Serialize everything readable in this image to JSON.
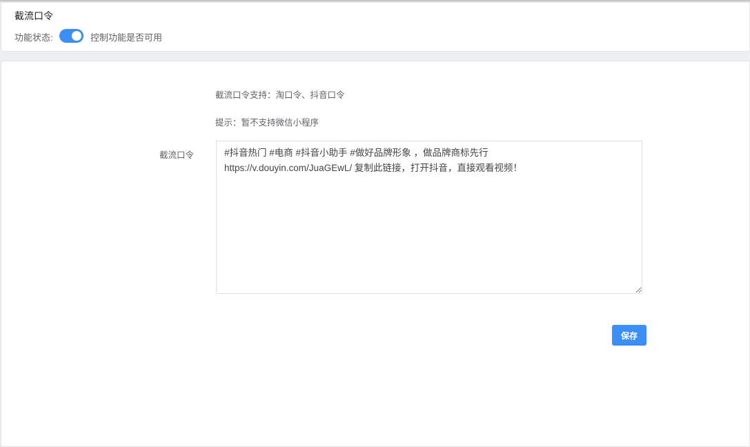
{
  "header": {
    "title": "截流口令",
    "status_label": "功能状态:",
    "status_enabled": true,
    "status_desc": "控制功能是否可用"
  },
  "form": {
    "support_text": "截流口令支持：淘口令、抖音口令",
    "hint_text": "提示：暂不支持微信小程序",
    "field_label": "截流口令",
    "field_value": "#抖音热门 #电商 #抖音小助手 #做好品牌形象 ，做品牌商标先行\nhttps://v.douyin.com/JuaGEwL/ 复制此链接，打开抖音，直接观看视频！",
    "save_label": "保存"
  },
  "colors": {
    "accent": "#3a8ef6"
  }
}
